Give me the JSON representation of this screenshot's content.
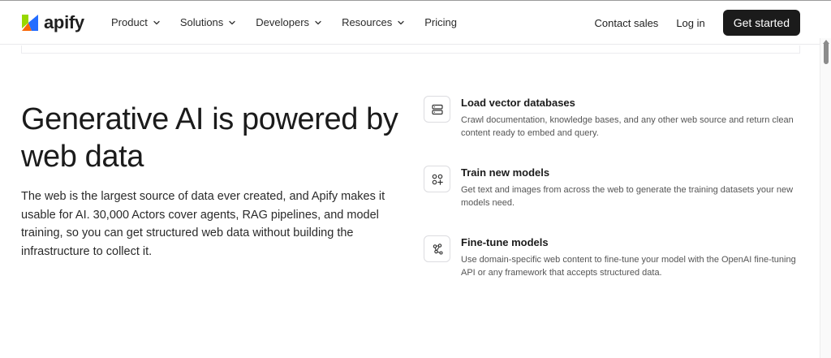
{
  "brand": {
    "name": "apify",
    "logo_colors": [
      "#97d700",
      "#f86606",
      "#246dff"
    ]
  },
  "nav": {
    "items": [
      {
        "label": "Product",
        "dropdown": true
      },
      {
        "label": "Solutions",
        "dropdown": true
      },
      {
        "label": "Developers",
        "dropdown": true
      },
      {
        "label": "Resources",
        "dropdown": true
      },
      {
        "label": "Pricing",
        "dropdown": false
      }
    ],
    "contact": "Contact sales",
    "login": "Log in",
    "cta": "Get started"
  },
  "hero": {
    "headline": "Generative AI is powered by web data",
    "body": "The web is the largest source of data ever created, and Apify makes it usable for AI. 30,000 Actors cover agents, RAG pipelines, and model training, so you can get structured web data without building the infrastructure to collect it."
  },
  "features": [
    {
      "icon": "database-icon",
      "title": "Load vector databases",
      "description": "Crawl documentation, knowledge bases, and any other web source and return clean content ready to embed and query."
    },
    {
      "icon": "grid-plus-icon",
      "title": "Train new models",
      "description": "Get text and images from across the web to generate the training datasets your new models need."
    },
    {
      "icon": "network-icon",
      "title": "Fine-tune models",
      "description": "Use domain-specific web content to fine-tune your model with the OpenAI fine-tuning API or any framework that accepts structured data."
    }
  ],
  "colors": {
    "cta_bg": "#1b1b1b",
    "text": "#1b1b1b",
    "muted": "#555555"
  }
}
